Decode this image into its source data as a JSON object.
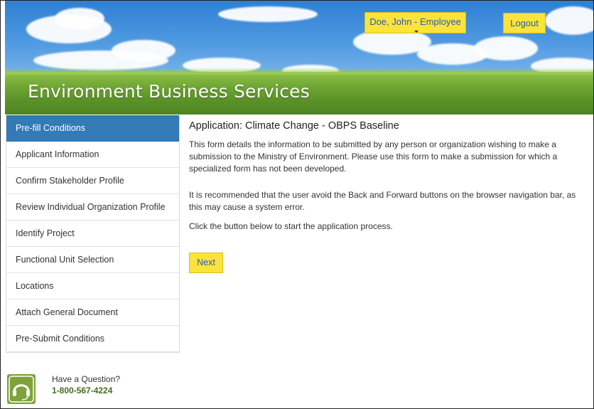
{
  "header": {
    "title": "Environment Business Services",
    "user_label": "Doe, John - Employee",
    "logout_label": "Logout"
  },
  "sidebar": {
    "items": [
      {
        "label": "Pre-fill Conditions",
        "active": true
      },
      {
        "label": "Applicant Information",
        "active": false
      },
      {
        "label": "Confirm Stakeholder Profile",
        "active": false
      },
      {
        "label": "Review Individual Organization Profile",
        "active": false
      },
      {
        "label": "Identify Project",
        "active": false
      },
      {
        "label": "Functional Unit Selection",
        "active": false
      },
      {
        "label": "Locations",
        "active": false
      },
      {
        "label": "Attach General Document",
        "active": false
      },
      {
        "label": "Pre-Submit Conditions",
        "active": false
      }
    ]
  },
  "main": {
    "heading": "Application: Climate Change - OBPS Baseline",
    "paragraph1": "This form details the information to be submitted by any person or organization wishing to make a submission to the Ministry of Environment. Please use this form to make a submission for which a specialized form has not been developed.",
    "paragraph2": "It is recommended that the user avoid the Back and Forward buttons on the browser navigation bar, as this may cause a system error.",
    "paragraph3": "Click the button below to start the application process.",
    "next_label": "Next"
  },
  "help": {
    "question": "Have a Question?",
    "phone": "1-800-567-4224",
    "icon": "headset-icon"
  },
  "colors": {
    "accent_yellow": "#fce33a",
    "active_blue": "#337ab7",
    "link_blue": "#2a5db0",
    "help_green": "#7fa33a"
  }
}
